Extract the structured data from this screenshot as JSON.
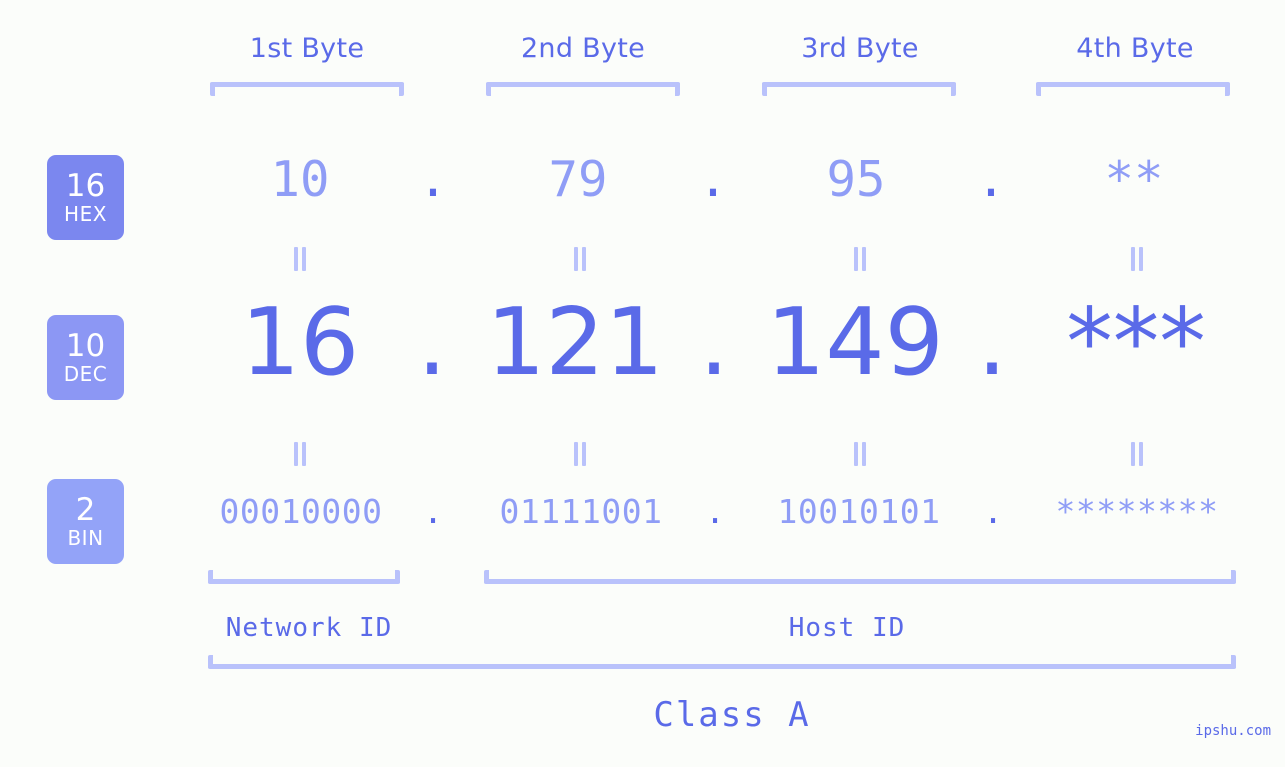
{
  "background_color": "#fbfdfa",
  "accent_color": "#5a6ae8",
  "muted_color": "#8f9df6",
  "bracket_color": "#b9c2fb",
  "byte_headers": [
    {
      "label": "1st Byte"
    },
    {
      "label": "2nd Byte"
    },
    {
      "label": "3rd Byte"
    },
    {
      "label": "4th Byte"
    }
  ],
  "bases": [
    {
      "number": "16",
      "name": "HEX",
      "color": "#7b87ef"
    },
    {
      "number": "10",
      "name": "DEC",
      "color": "#8c97f4"
    },
    {
      "number": "2",
      "name": "BIN",
      "color": "#93a3f8"
    }
  ],
  "rows": {
    "hex": {
      "values": [
        "10",
        "79",
        "95",
        "**"
      ],
      "separator": "."
    },
    "dec": {
      "values": [
        "16",
        "121",
        "149",
        "***"
      ],
      "separator": "."
    },
    "bin": {
      "values": [
        "00010000",
        "01111001",
        "10010101",
        "********"
      ],
      "separator": "."
    }
  },
  "connectors": {
    "symbol": "=",
    "count": 8
  },
  "segments": {
    "network_id": "Network ID",
    "host_id": "Host ID",
    "ip_class": "Class A"
  },
  "watermark": "ipshu.com"
}
